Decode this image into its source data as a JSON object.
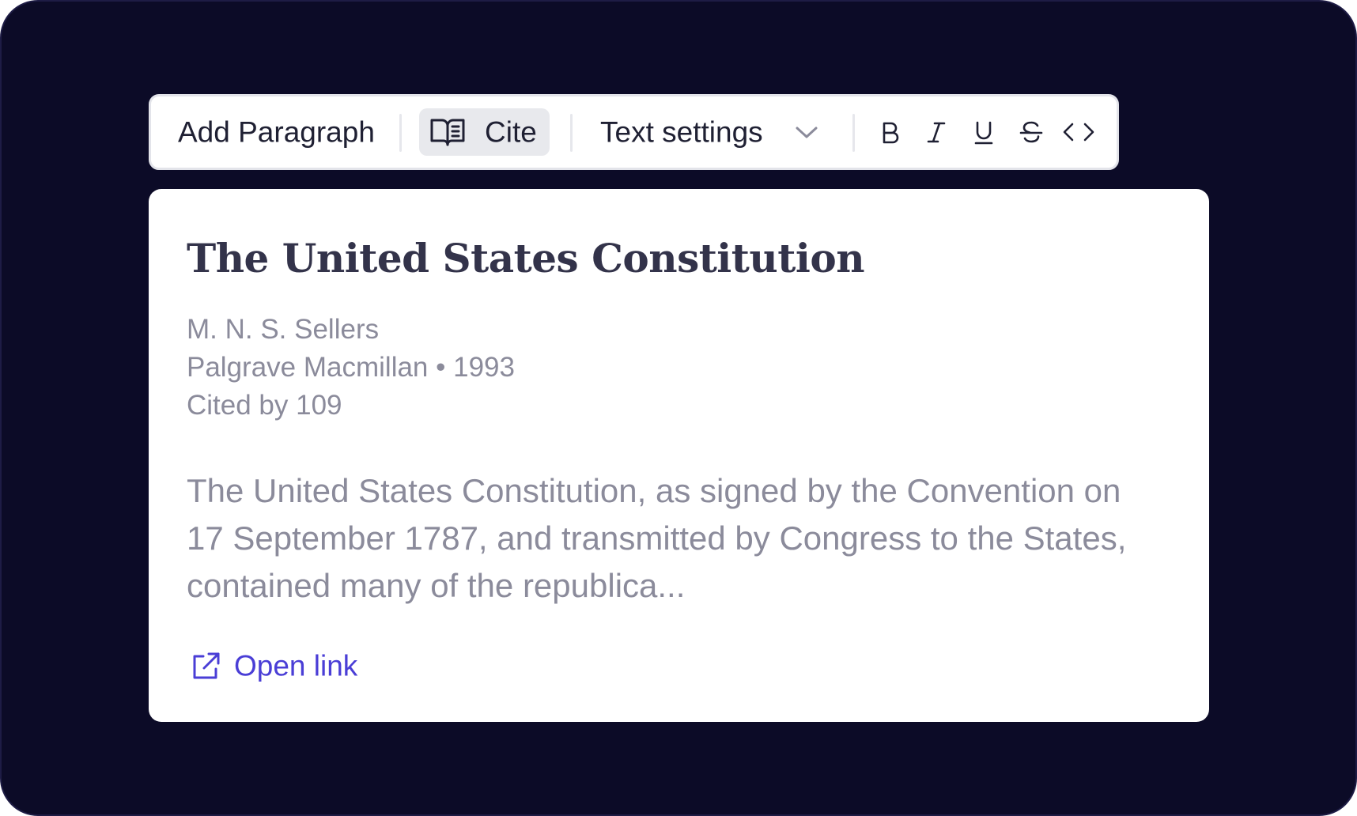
{
  "toolbar": {
    "add_paragraph_label": "Add Paragraph",
    "cite_label": "Cite",
    "cite_icon": "book-open-icon",
    "text_settings_label": "Text settings",
    "text_settings_icon": "chevron-down-icon",
    "format_buttons": [
      {
        "name": "bold",
        "icon": "bold-icon"
      },
      {
        "name": "italic",
        "icon": "italic-icon"
      },
      {
        "name": "underline",
        "icon": "underline-icon"
      },
      {
        "name": "strikethrough",
        "icon": "strikethrough-icon"
      },
      {
        "name": "code",
        "icon": "code-icon"
      }
    ],
    "colors": {
      "background": "#ffffff",
      "active_background": "#e8e9ed",
      "text": "#1f2033"
    }
  },
  "citation": {
    "title": "The United States Constitution",
    "author": "M. N. S. Sellers",
    "publisher_year": "Palgrave Macmillan • 1993",
    "cited_by": "Cited by 109",
    "abstract": "The United States Constitution, as signed by the Convention on 17 September 1787, and transmitted by Congress to the States, contained many of the republica...",
    "link_label": "Open link",
    "link_icon": "external-link-icon"
  },
  "colors": {
    "page_background": "#0c0b27",
    "title": "#33334a",
    "muted_text": "#8b8b9b",
    "link": "#4a3ed6"
  }
}
